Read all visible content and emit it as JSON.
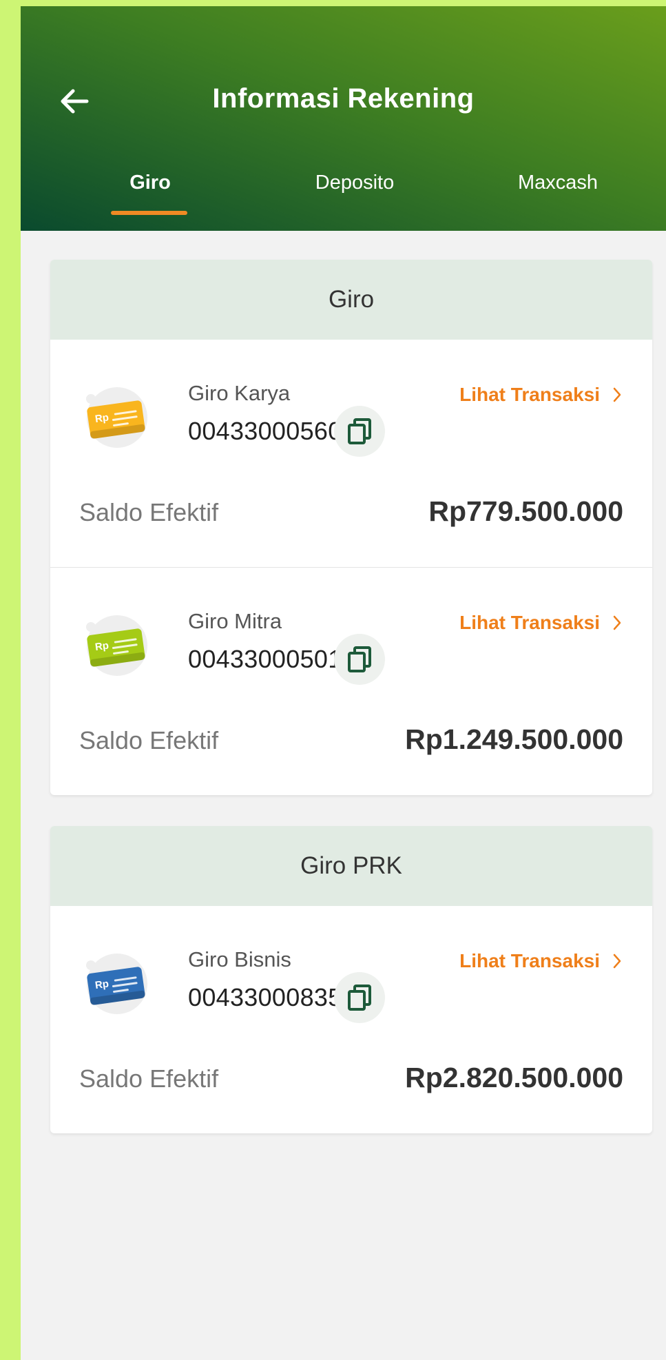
{
  "header": {
    "title": "Informasi Rekening",
    "back_icon": "arrow-left-icon"
  },
  "tabs": [
    {
      "label": "Giro",
      "active": true
    },
    {
      "label": "Deposito",
      "active": false
    },
    {
      "label": "Maxcash",
      "active": false
    }
  ],
  "colors": {
    "accent": "#ef7f1a",
    "header_dark": "#0a4a2e",
    "header_light": "#6a9e1c",
    "group_header_bg": "#e1ebe3",
    "copy_icon": "#1d5a3a"
  },
  "groups": [
    {
      "title": "Giro",
      "accounts": [
        {
          "name": "Giro Karya",
          "number": "00433000560",
          "link_label": "Lihat Transaksi",
          "saldo_label": "Saldo Efektif",
          "saldo_value": "Rp779.500.000",
          "card_color": "#f9b51e",
          "card_text": "Rp"
        },
        {
          "name": "Giro Mitra",
          "number": "00433000501",
          "link_label": "Lihat Transaksi",
          "saldo_label": "Saldo Efektif",
          "saldo_value": "Rp1.249.500.000",
          "card_color": "#a5cb16",
          "card_text": "Rp"
        }
      ]
    },
    {
      "title": "Giro PRK",
      "accounts": [
        {
          "name": "Giro Bisnis",
          "number": "00433000835",
          "link_label": "Lihat Transaksi",
          "saldo_label": "Saldo Efektif",
          "saldo_value": "Rp2.820.500.000",
          "card_color": "#2f6fb8",
          "card_text": "Rp"
        }
      ]
    }
  ]
}
